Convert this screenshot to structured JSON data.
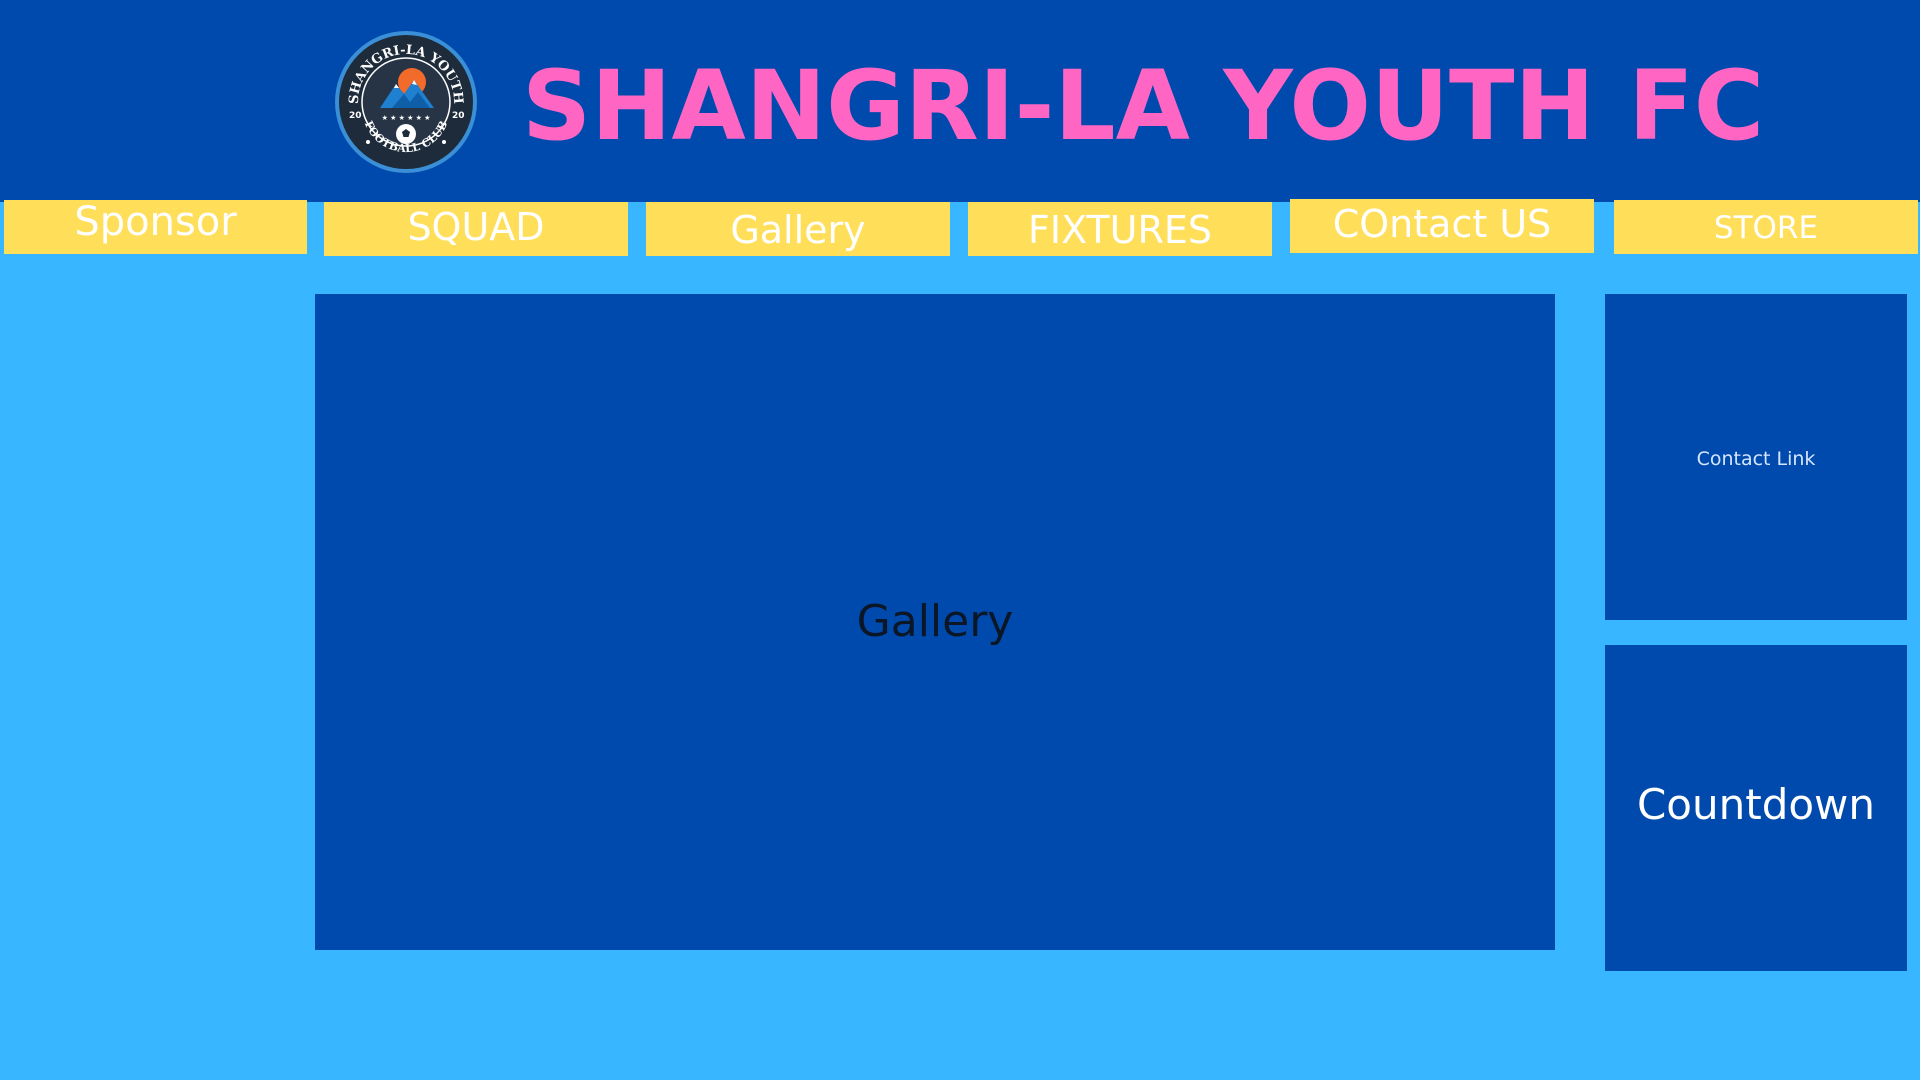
{
  "header": {
    "title": "SHANGRI-LA YOUTH FC",
    "logo": {
      "top_text": "SHANGRI-LA YOUTH",
      "bottom_text": "FOOTBALL CLUB",
      "year_left": "20",
      "year_right": "20",
      "icon": "club-crest-icon"
    }
  },
  "nav": {
    "tabs": [
      {
        "label": "Sponsor"
      },
      {
        "label": "SQUAD"
      },
      {
        "label": "Gallery"
      },
      {
        "label": "FIXTURES"
      },
      {
        "label": "COntact US"
      },
      {
        "label": "STORE"
      }
    ]
  },
  "main": {
    "gallery_label": "Gallery"
  },
  "sidebar": {
    "contact_label": "Contact Link",
    "countdown_label": "Countdown"
  },
  "colors": {
    "page_background": "#38b6ff",
    "header_background": "#004aad",
    "title_color": "#ff66c4",
    "tab_background": "#ffde59",
    "tab_text": "#ffffff",
    "panel_background": "#004aad"
  }
}
